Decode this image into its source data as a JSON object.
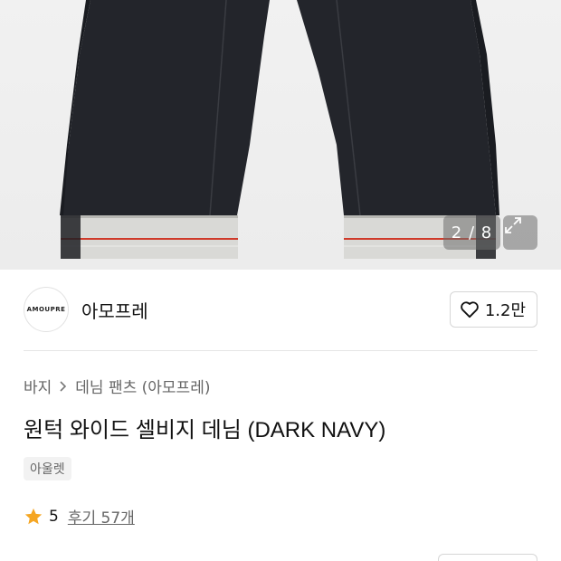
{
  "product_image": {
    "counter": "2 / 8",
    "expand_icon": "expand-arrows-icon",
    "colors": {
      "background": "#eeeeee",
      "denim": "#23252b",
      "selvedge": "#cf3a2a"
    }
  },
  "brand": {
    "logo_text": "AMOUPRE",
    "name": "아모프레",
    "like_icon": "heart-icon",
    "like_count": "1.2만"
  },
  "breadcrumb": {
    "items": [
      "바지",
      "데님 팬츠 (아모프레)"
    ],
    "separator_icon": "chevron-right-icon"
  },
  "product": {
    "title": "원턱 와이드 셀비지 데님 (DARK NAVY)",
    "tag": "아울렛",
    "rating": "5",
    "reviews": "후기 57개",
    "star_color": "#f5a623"
  }
}
